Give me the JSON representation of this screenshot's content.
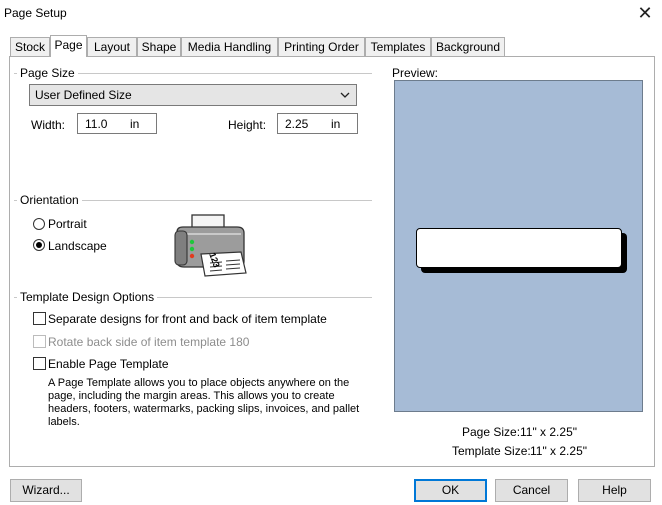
{
  "window": {
    "title": "Page Setup"
  },
  "tabs": [
    "Stock",
    "Page",
    "Layout",
    "Shape",
    "Media Handling",
    "Printing Order",
    "Templates",
    "Background"
  ],
  "active_tab": "Page",
  "page_size": {
    "group_label": "Page Size",
    "selected": "User Defined Size",
    "width_label": "Width:",
    "width_value": "11.0",
    "width_unit": "in",
    "height_label": "Height:",
    "height_value": "2.25",
    "height_unit": "in"
  },
  "orientation": {
    "group_label": "Orientation",
    "options": [
      "Portrait",
      "Landscape"
    ],
    "selected": "Landscape"
  },
  "template_options": {
    "group_label": "Template Design Options",
    "separate_designs": {
      "label": "Separate designs for front and back of item template",
      "checked": false,
      "enabled": true
    },
    "rotate_back": {
      "label": "Rotate back side of item template 180",
      "checked": false,
      "enabled": false
    },
    "enable_page_template": {
      "label": "Enable Page Template",
      "checked": false,
      "enabled": true
    },
    "description": "A Page Template allows you to place objects anywhere on the page, including the margin areas. This allows you to create headers, footers, watermarks, packing slips, invoices, and pallet labels."
  },
  "preview": {
    "label": "Preview:",
    "page_size_label": "Page Size:",
    "page_size_value": "11\" x 2.25\"",
    "template_size_label": "Template Size:",
    "template_size_value": "11\" x 2.25\""
  },
  "printer_icon_text": "123",
  "buttons": {
    "wizard": "Wizard...",
    "ok": "OK",
    "cancel": "Cancel",
    "help": "Help"
  },
  "colors": {
    "preview_bg": "#a6bbd6",
    "accent": "#0078d7"
  },
  "icons": {
    "close": "close-icon",
    "dropdown": "chevron-down-icon",
    "printer": "printer-icon"
  }
}
